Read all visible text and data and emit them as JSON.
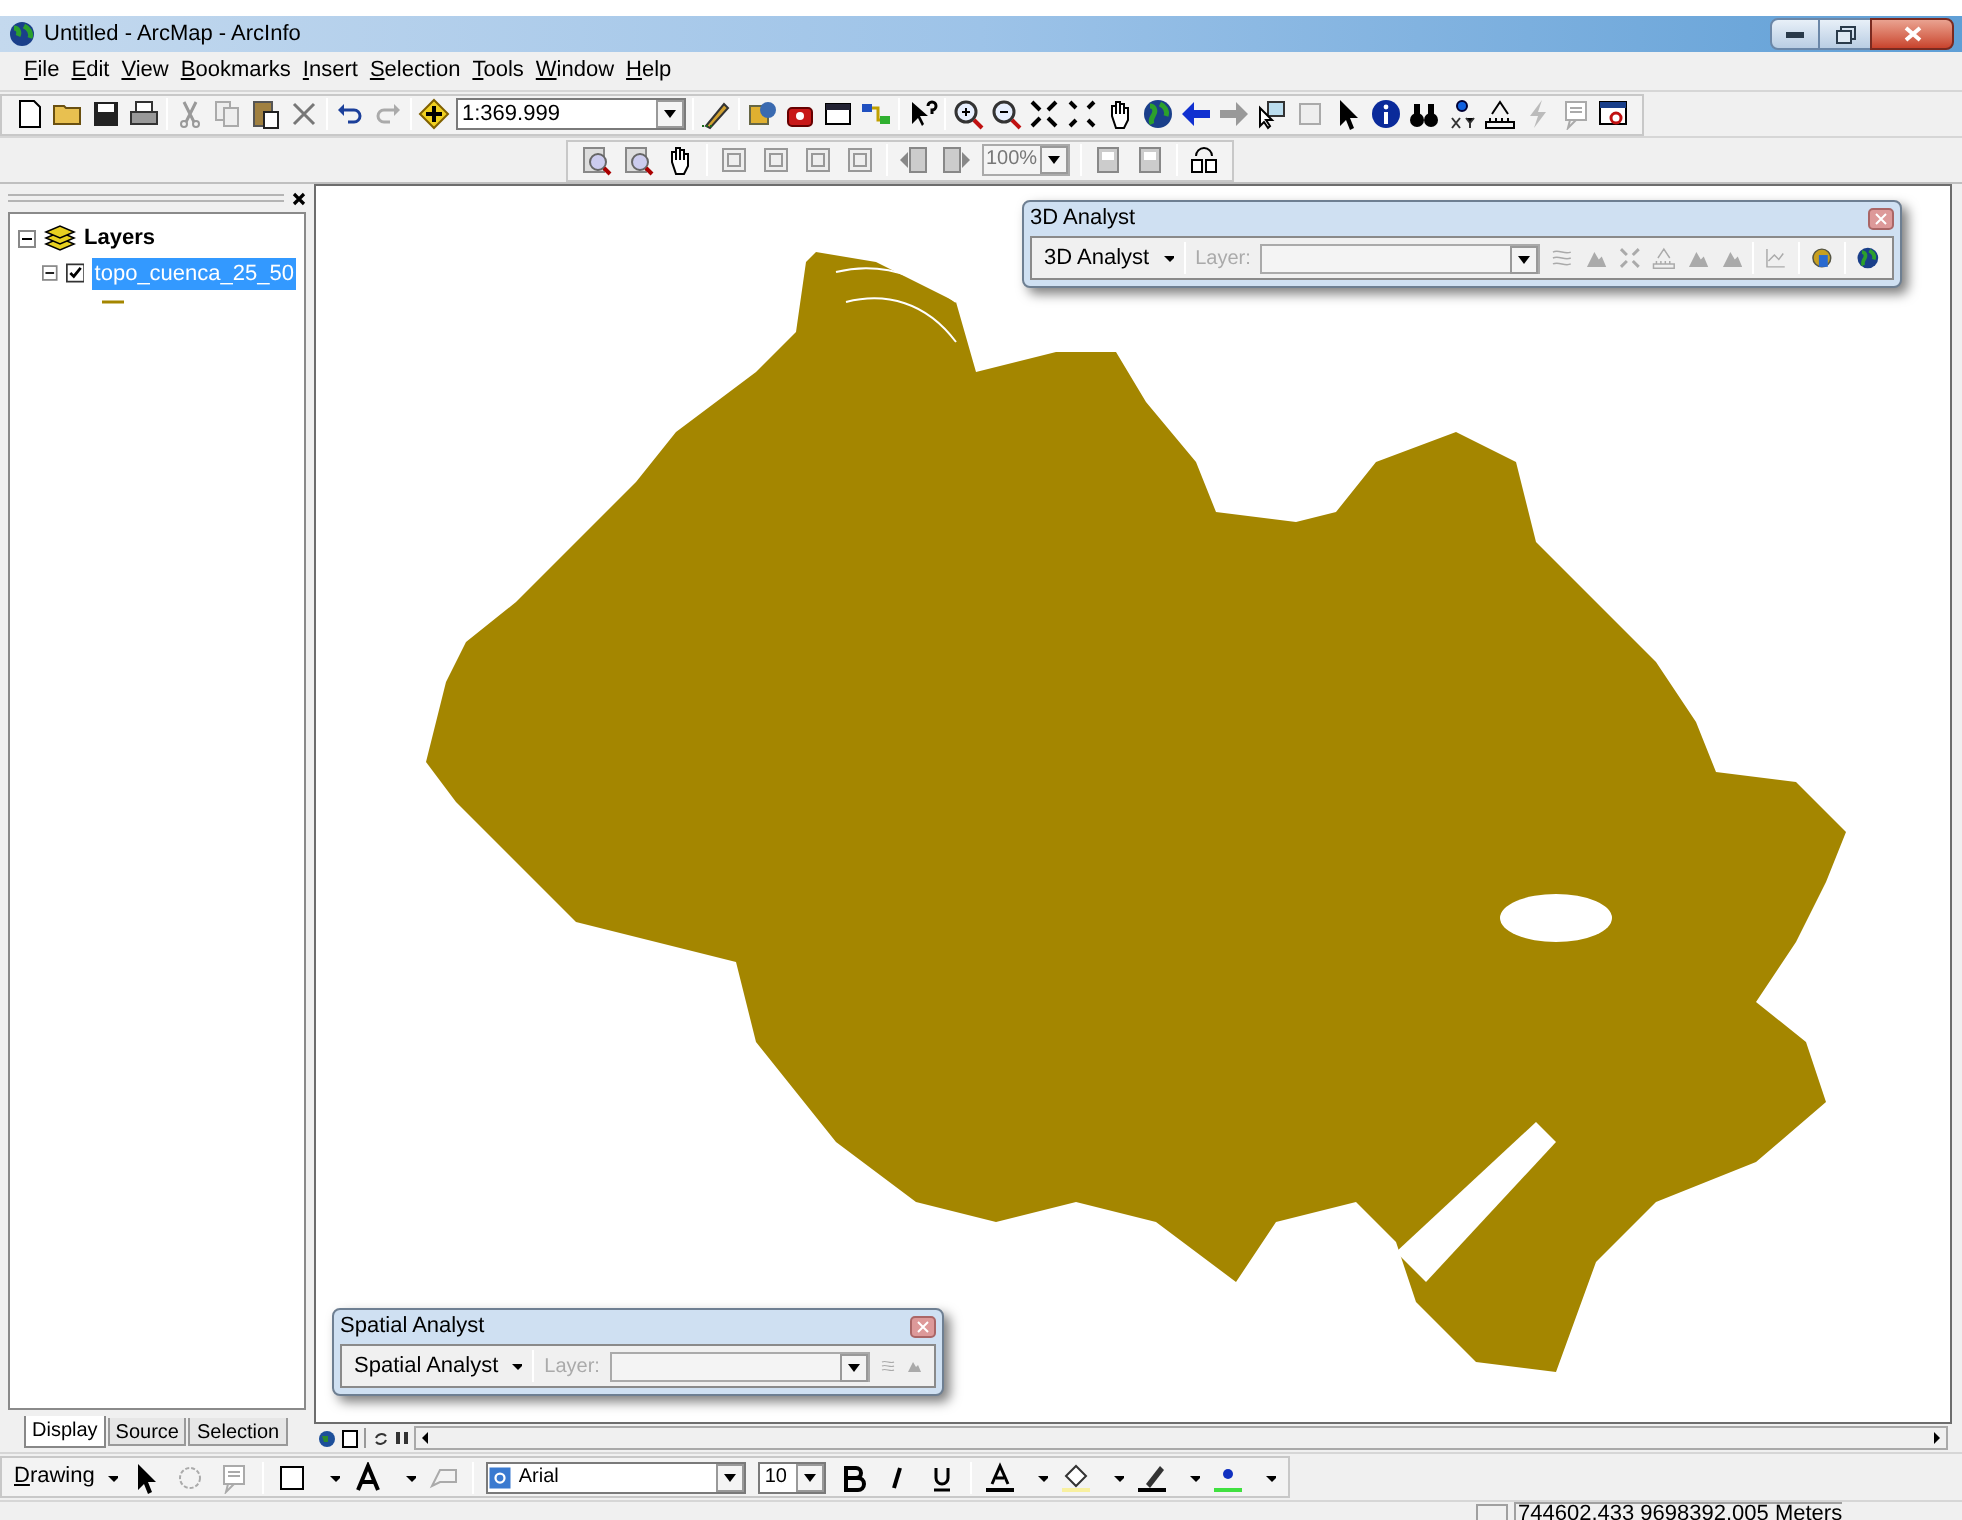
{
  "window": {
    "title": "Untitled - ArcMap - ArcInfo"
  },
  "menu": [
    {
      "label": "File"
    },
    {
      "label": "Edit"
    },
    {
      "label": "View"
    },
    {
      "label": "Bookmarks"
    },
    {
      "label": "Insert"
    },
    {
      "label": "Selection"
    },
    {
      "label": "Tools"
    },
    {
      "label": "Window"
    },
    {
      "label": "Help"
    }
  ],
  "standard_toolbar": {
    "map_scale": "1:369.999"
  },
  "layout_toolbar": {
    "zoom_percent": "100%"
  },
  "table_of_contents": {
    "root": {
      "label": "Layers",
      "expanded": true,
      "children": [
        {
          "label": "topo_cuenca_25_50",
          "checked": true,
          "selected": true,
          "expanded": true
        }
      ]
    },
    "tabs": [
      {
        "label": "Display",
        "selected": true
      },
      {
        "label": "Source",
        "selected": false
      },
      {
        "label": "Selection",
        "selected": false
      }
    ]
  },
  "analyst_windows": [
    {
      "title": "3D Analyst",
      "menu": "3D Analyst",
      "layer_label": "Layer:",
      "kind": "terrain"
    },
    {
      "title": "Spatial Analyst",
      "menu": "Spatial Analyst",
      "layer_label": "Layer:",
      "kind": "spatial"
    }
  ],
  "drawing_toolbar": {
    "menu": "Drawing",
    "font": "Arial",
    "font_size": "10"
  },
  "status_bar": {
    "coordinates": "744602.433  9698392.005 Meters"
  }
}
